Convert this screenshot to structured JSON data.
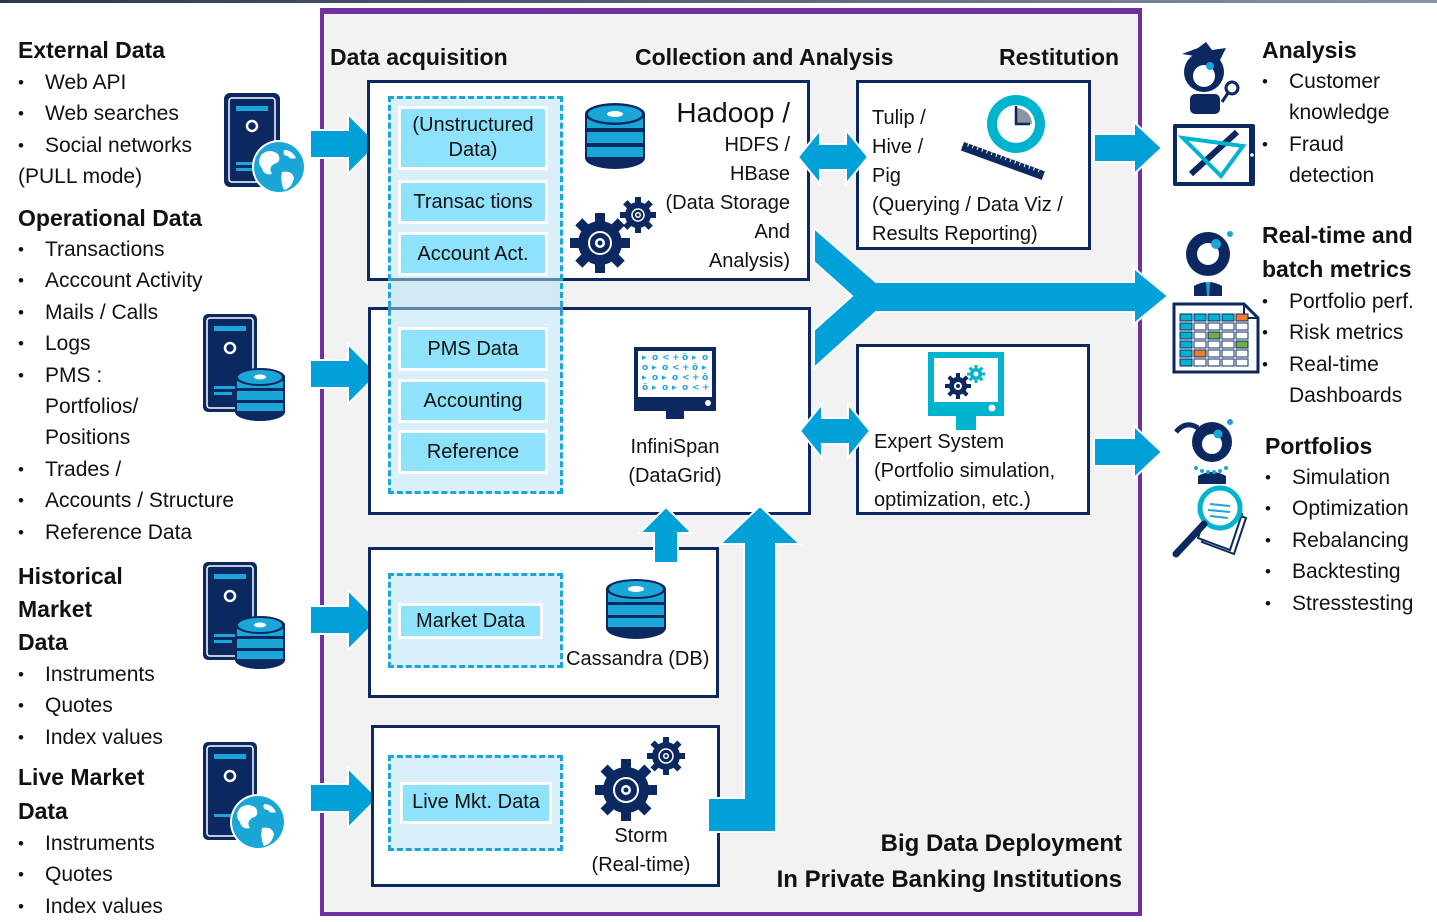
{
  "diagram": {
    "title_line1": "Big Data Deployment",
    "title_line2": "In Private Banking Institutions"
  },
  "columns": {
    "acquisition": "Data acquisition",
    "collection": "Collection and Analysis",
    "restitution": "Restitution"
  },
  "sources": [
    {
      "title": "External Data",
      "items": [
        "Web API",
        "Web searches",
        "Social networks"
      ],
      "note": "(PULL mode)",
      "icon": "server-globe-icon"
    },
    {
      "title": "Operational Data",
      "items": [
        "Transactions",
        "Acccount  Activity",
        "Mails / Calls",
        "Logs",
        "PMS :",
        "Trades /",
        "Accounts / Structure",
        "Reference Data"
      ],
      "continuations": [
        "Portfolios/",
        "Positions"
      ],
      "icon": "server-database-icon"
    },
    {
      "title_lines": [
        "Historical",
        "Market",
        "Data"
      ],
      "items": [
        "Instruments",
        "Quotes",
        "Index values"
      ],
      "icon": "server-database-icon"
    },
    {
      "title_lines": [
        "Live Market",
        "Data"
      ],
      "items": [
        "Instruments",
        "Quotes",
        "Index values"
      ],
      "icon": "server-globe-icon"
    }
  ],
  "acquisition": {
    "hadoop_chips": [
      "(Unstructured Data)",
      "Transac tions",
      "Account Act."
    ],
    "infinispan_chips": [
      "PMS Data",
      "Accounting",
      "Reference"
    ],
    "cassandra_chips": [
      "Market Data"
    ],
    "storm_chips": [
      "Live Mkt. Data"
    ]
  },
  "systems": {
    "hadoop": {
      "name": "Hadoop /",
      "lines": [
        "HDFS /",
        "HBase",
        "(Data Storage",
        "And",
        "Analysis)"
      ]
    },
    "infinispan": {
      "lines": [
        "InfiniSpan",
        "(DataGrid)"
      ]
    },
    "cassandra": {
      "lines": [
        "Cassandra (DB)"
      ]
    },
    "storm": {
      "lines": [
        "Storm",
        "(Real-time)"
      ]
    },
    "tulip": {
      "lines": [
        "Tulip /",
        "Hive /",
        "Pig",
        "(Querying / Data Viz /",
        "Results Reporting)"
      ]
    },
    "expert": {
      "lines": [
        "Expert System",
        "(Portfolio simulation,",
        "optimization, etc.)"
      ]
    }
  },
  "outputs": [
    {
      "title": "Analysis",
      "items": [
        "Customer",
        "Fraud"
      ],
      "continuations": [
        "knowledge",
        "detection"
      ]
    },
    {
      "title_lines": [
        "Real-time and",
        "batch metrics"
      ],
      "items": [
        "Portfolio perf.",
        "Risk metrics",
        "Real-time"
      ],
      "continuations": [
        "Dashboards"
      ]
    },
    {
      "title": "Portfolios",
      "items": [
        "Simulation",
        "Optimization",
        "Rebalancing",
        "Backtesting",
        "Stresstesting"
      ]
    }
  ],
  "colors": {
    "frame": "#7030a0",
    "navy": "#0b2860",
    "arrow": "#00a0d8",
    "chip": "#8ee2fb",
    "teal": "#00b4d0",
    "orange": "#ed7d31",
    "green": "#70ad47"
  }
}
